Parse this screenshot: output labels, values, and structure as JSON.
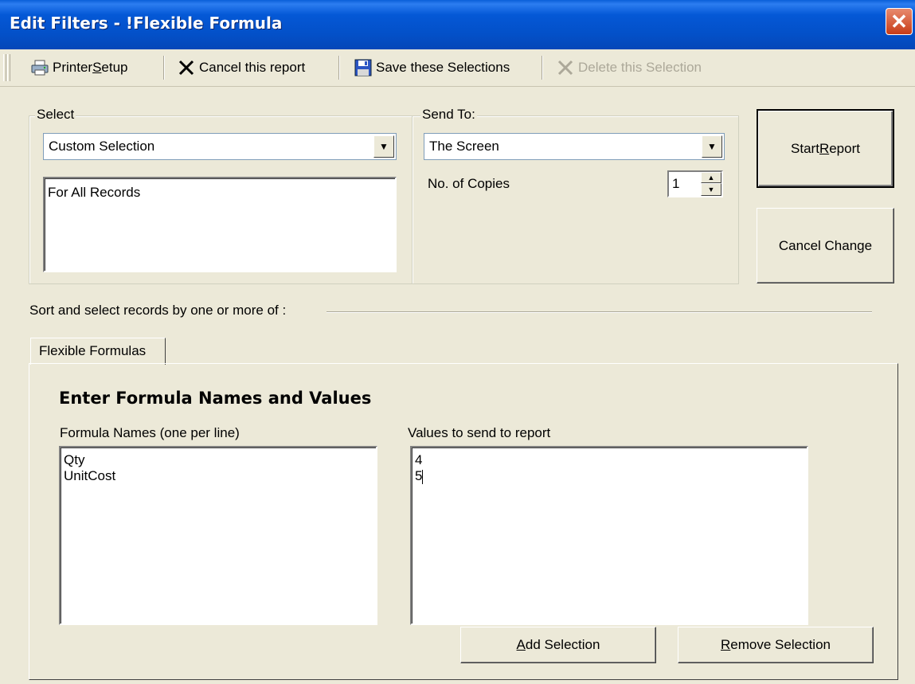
{
  "window": {
    "title": "Edit Filters - !Flexible Formula",
    "close_glyph": "✕"
  },
  "toolbar": {
    "printer_setup": {
      "pre": "Printer ",
      "key": "S",
      "post": "etup",
      "icon": "printer-icon"
    },
    "cancel_report": {
      "label": "Cancel this report",
      "icon": "x-icon"
    },
    "save_selections": {
      "label": "Save these Selections",
      "icon": "floppy-disk-icon"
    },
    "delete_selection": {
      "label": "Delete this Selection",
      "icon": "x-icon",
      "disabled": true
    }
  },
  "select_group": {
    "label": "Select",
    "combo_value": "Custom Selection",
    "list_text": "For All Records"
  },
  "send_group": {
    "label": "Send To:",
    "combo_value": "The Screen",
    "copies_label": "No. of Copies",
    "copies_value": "1"
  },
  "buttons": {
    "start_report": {
      "pre": "Start ",
      "key": "R",
      "post": "eport"
    },
    "cancel_change": "Cancel Change",
    "add_selection": {
      "pre": "",
      "key": "A",
      "post": "dd Selection"
    },
    "remove_selection": {
      "pre": "",
      "key": "R",
      "post": "emove Selection"
    }
  },
  "sort_label": "Sort and select records by one or more of :",
  "tabs": [
    {
      "label": "Flexible Formulas",
      "selected": true
    }
  ],
  "formula_panel": {
    "heading": "Enter Formula Names and Values",
    "names_label": "Formula Names (one per line)",
    "values_label": "Values to send to report",
    "names": [
      "Qty",
      "UnitCost"
    ],
    "values": [
      "4",
      "5"
    ]
  }
}
